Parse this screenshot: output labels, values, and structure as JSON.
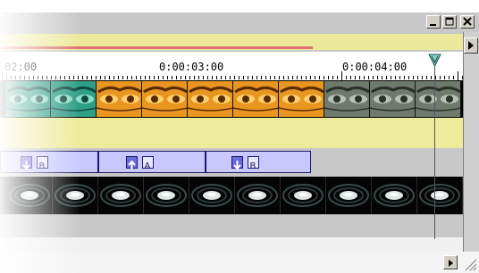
{
  "window": {
    "buttons": {
      "minimize": "minimize",
      "maximize": "maximize",
      "close": "close"
    }
  },
  "ruler": {
    "labels": [
      "02:00",
      "0:00:03:00",
      "0:00:04:00"
    ]
  },
  "tracks": {
    "video_clips": [
      {
        "tint": "teal",
        "frames": 2
      },
      {
        "tint": "orange",
        "frames": 5
      },
      {
        "tint": "gray",
        "frames": 3
      }
    ],
    "transitions": [
      {
        "direction": "down"
      },
      {
        "direction": "up"
      },
      {
        "direction": "down"
      }
    ]
  },
  "colors": {
    "navbar": "#ece99a",
    "work_area": "#e07070",
    "transition_fill": "#c8c8ff",
    "teal": "#2f9e86",
    "orange": "#e89620",
    "gray_clip": "#6f7a6f"
  },
  "icons": {
    "playhead": "playhead-marker-icon",
    "scroll_right": "triangle-right-icon"
  }
}
